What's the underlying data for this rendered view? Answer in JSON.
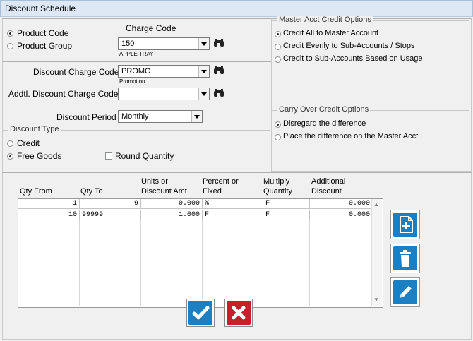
{
  "window": {
    "title": "Discount Schedule"
  },
  "charge": {
    "product_code_label": "Product Code",
    "product_group_label": "Product Group",
    "charge_code_header": "Charge Code",
    "charge_code_value": "150",
    "charge_code_desc": "APPLE TRAY",
    "selected": "Product Code"
  },
  "discount": {
    "discount_charge_code_label": "Discount Charge Code",
    "discount_charge_code_value": "PROMO",
    "discount_charge_code_desc": "Promotion",
    "addtl_label": "Addtl. Discount Charge Code.",
    "addtl_value": "",
    "period_label": "Discount Period",
    "period_value": "Monthly"
  },
  "discount_type": {
    "legend": "Discount Type",
    "credit_label": "Credit",
    "free_goods_label": "Free Goods",
    "round_quantity_label": "Round Quantity",
    "selected": "Free Goods",
    "round_quantity_checked": false
  },
  "master_acct": {
    "legend": "Master Acct Credit Options",
    "options": [
      "Credit All to Master Account",
      "Credit Evenly to Sub-Accounts / Stops",
      "Credit to Sub-Accounts Based on Usage"
    ],
    "selected": "Credit All to Master Account"
  },
  "carry_over": {
    "legend": "Carry Over Credit Options",
    "options": [
      "Disregard the difference",
      "Place the difference on the Master Acct"
    ],
    "selected": "Disregard the difference"
  },
  "table": {
    "headers": {
      "qty_from": "Qty From",
      "qty_to": "Qty To",
      "units_1": "Units or",
      "units_2": "Discount Amt",
      "pct_1": "Percent or",
      "pct_2": "Fixed",
      "mult_1": "Multiply",
      "mult_2": "Quantity",
      "add_1": "Additional",
      "add_2": "Discount"
    },
    "rows": [
      {
        "qty_from": "1",
        "qty_to": "9",
        "units": "0.000",
        "pct": "%",
        "mult": "F",
        "add": "0.000"
      },
      {
        "qty_from": "10",
        "qty_to": "99999",
        "units": "1.000",
        "pct": "F",
        "mult": "F",
        "add": "0.000"
      }
    ]
  },
  "icons": {
    "binoculars": "binoculars-icon",
    "add": "add-document-icon",
    "delete": "trash-icon",
    "edit": "pencil-icon",
    "ok": "checkmark-icon",
    "cancel": "x-icon"
  },
  "colors": {
    "blue_button": "#1b7fc1",
    "red_button": "#c8202a"
  }
}
